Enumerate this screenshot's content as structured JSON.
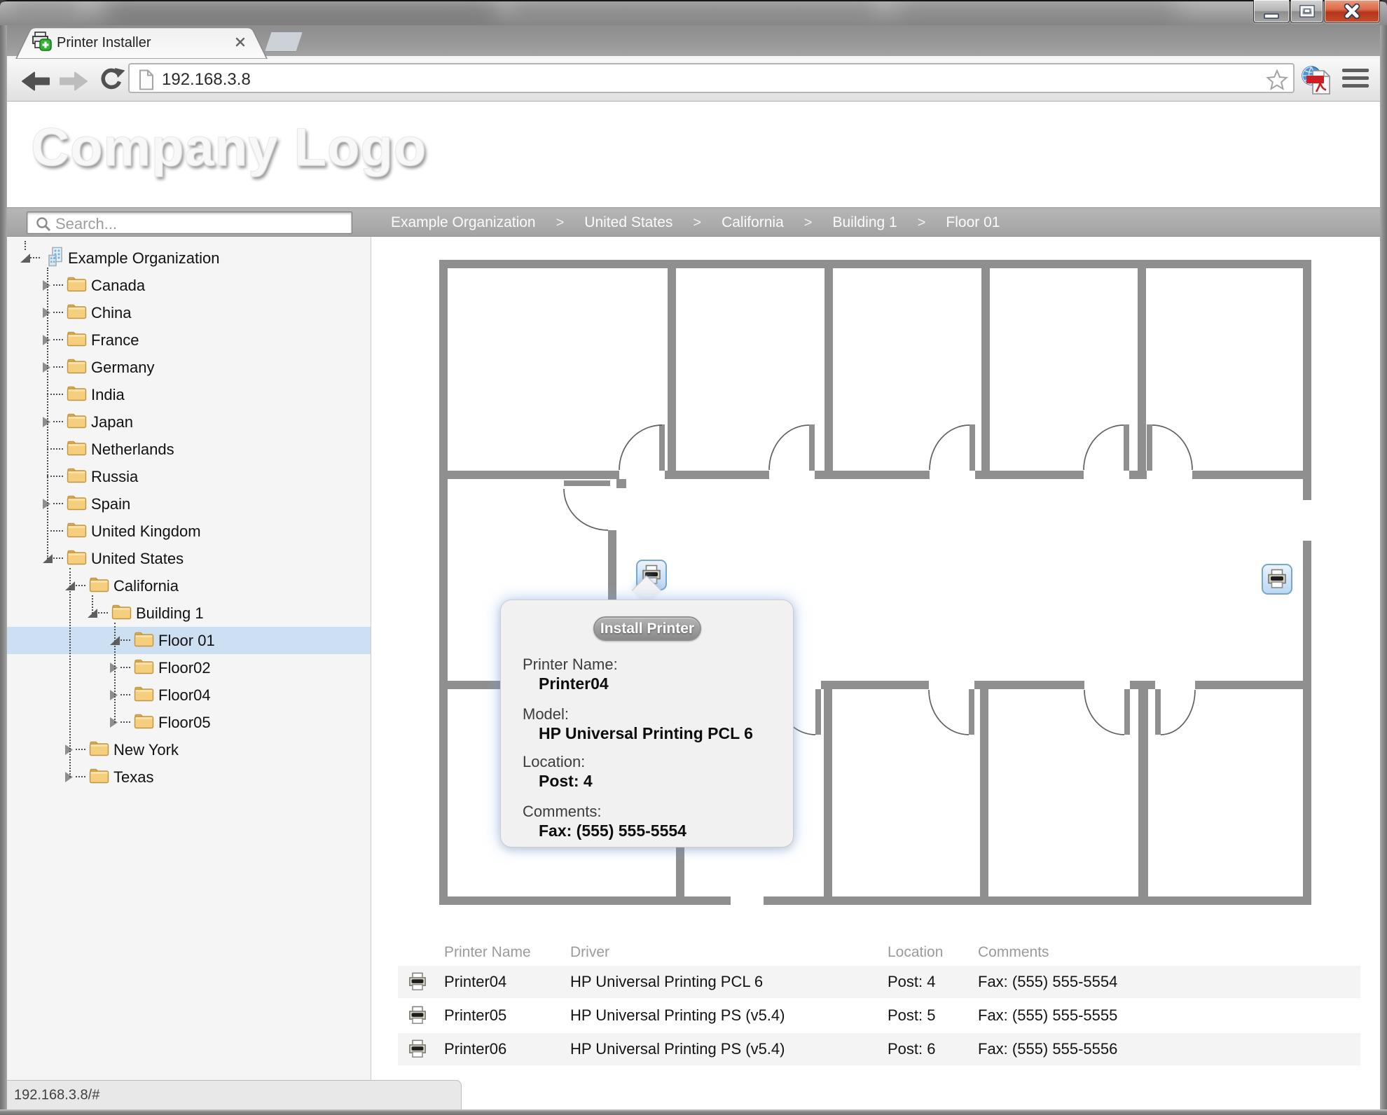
{
  "window": {
    "buttons": {
      "minimize": "minimize",
      "maximize": "maximize",
      "close": "close"
    }
  },
  "browser": {
    "tab": {
      "title": "Printer Installer"
    },
    "url": "192.168.3.8",
    "status_text": "192.168.3.8/#"
  },
  "header": {
    "logo_text": "Company Logo"
  },
  "search": {
    "placeholder": "Search..."
  },
  "breadcrumb": {
    "separator": ">",
    "items": [
      "Example Organization",
      "United States",
      "California",
      "Building 1",
      "Floor 01"
    ]
  },
  "tree": {
    "root": {
      "label": "Example Organization",
      "icon": "building",
      "state": "expanded",
      "children": [
        {
          "label": "Canada",
          "state": "collapsed"
        },
        {
          "label": "China",
          "state": "collapsed"
        },
        {
          "label": "France",
          "state": "collapsed"
        },
        {
          "label": "Germany",
          "state": "collapsed"
        },
        {
          "label": "India",
          "state": "leaf"
        },
        {
          "label": "Japan",
          "state": "collapsed"
        },
        {
          "label": "Netherlands",
          "state": "leaf"
        },
        {
          "label": "Russia",
          "state": "leaf"
        },
        {
          "label": "Spain",
          "state": "collapsed"
        },
        {
          "label": "United Kingdom",
          "state": "leaf"
        },
        {
          "label": "United States",
          "state": "expanded",
          "children": [
            {
              "label": "California",
              "state": "expanded",
              "children": [
                {
                  "label": "Building 1",
                  "state": "expanded",
                  "children": [
                    {
                      "label": "Floor 01",
                      "state": "expanded",
                      "selected": true
                    },
                    {
                      "label": "Floor02",
                      "state": "collapsed"
                    },
                    {
                      "label": "Floor04",
                      "state": "collapsed"
                    },
                    {
                      "label": "Floor05",
                      "state": "collapsed"
                    }
                  ]
                }
              ]
            },
            {
              "label": "New York",
              "state": "collapsed"
            },
            {
              "label": "Texas",
              "state": "collapsed"
            }
          ]
        }
      ]
    }
  },
  "map": {
    "tooltip": {
      "button_label": "Install Printer",
      "fields": [
        {
          "label": "Printer Name:",
          "value": "Printer04"
        },
        {
          "label": "Model:",
          "value": "HP Universal Printing PCL 6"
        },
        {
          "label": "Location:",
          "value": "Post: 4"
        },
        {
          "label": "Comments:",
          "value": "Fax: (555) 555-5554"
        }
      ]
    }
  },
  "table": {
    "columns": [
      "Printer Name",
      "Driver",
      "Location",
      "Comments"
    ],
    "rows": [
      {
        "name": "Printer04",
        "driver": "HP Universal Printing PCL 6",
        "location": "Post: 4",
        "comments": "Fax: (555) 555-5554"
      },
      {
        "name": "Printer05",
        "driver": "HP Universal Printing PS (v5.4)",
        "location": "Post: 5",
        "comments": "Fax: (555) 555-5555"
      },
      {
        "name": "Printer06",
        "driver": "HP Universal Printing PS (v5.4)",
        "location": "Post: 6",
        "comments": "Fax: (555) 555-5556"
      }
    ]
  }
}
